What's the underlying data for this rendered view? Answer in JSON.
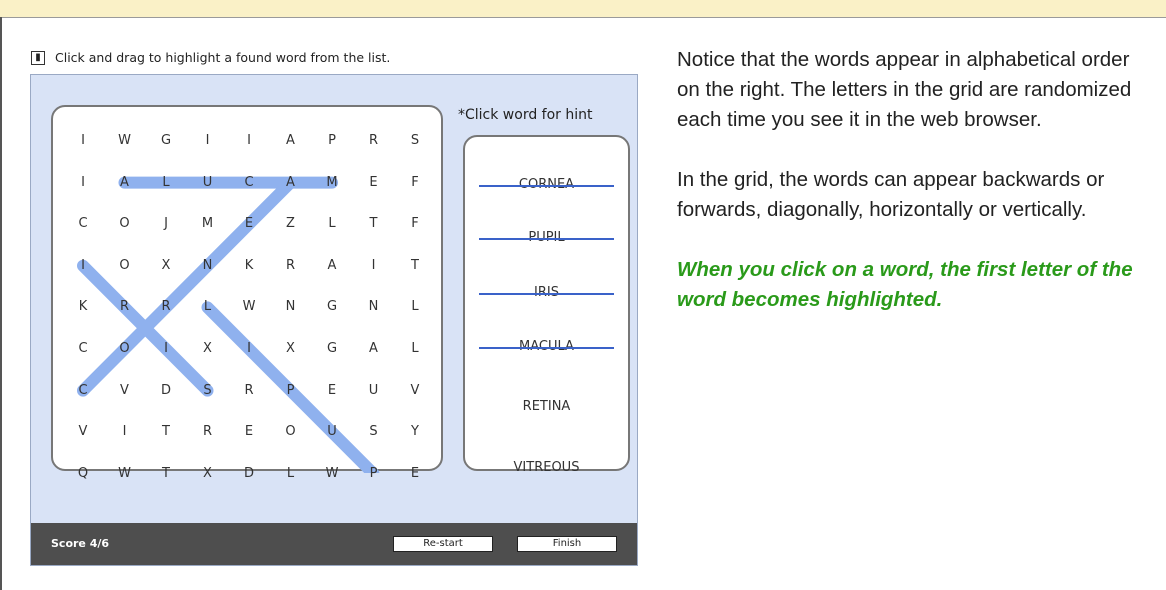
{
  "instruction": {
    "text": "Click and drag to highlight a found word from the list.",
    "icon": "mouse-drag-icon"
  },
  "grid": {
    "rows": [
      [
        "I",
        "W",
        "G",
        "I",
        "I",
        "A",
        "P",
        "R",
        "S"
      ],
      [
        "I",
        "A",
        "L",
        "U",
        "C",
        "A",
        "M",
        "E",
        "F"
      ],
      [
        "C",
        "O",
        "J",
        "M",
        "E",
        "Z",
        "L",
        "T",
        "F"
      ],
      [
        "I",
        "O",
        "X",
        "N",
        "K",
        "R",
        "A",
        "I",
        "T"
      ],
      [
        "K",
        "R",
        "R",
        "L",
        "W",
        "N",
        "G",
        "N",
        "L"
      ],
      [
        "C",
        "O",
        "I",
        "X",
        "I",
        "X",
        "G",
        "A",
        "L"
      ],
      [
        "C",
        "V",
        "D",
        "S",
        "R",
        "P",
        "E",
        "U",
        "V"
      ],
      [
        "V",
        "I",
        "T",
        "R",
        "E",
        "O",
        "U",
        "S",
        "Y"
      ],
      [
        "Q",
        "W",
        "T",
        "X",
        "D",
        "L",
        "W",
        "P",
        "E"
      ]
    ]
  },
  "hint_label": "*Click word for hint",
  "words": [
    {
      "text": "CORNEA",
      "found": true
    },
    {
      "text": "PUPIL",
      "found": true
    },
    {
      "text": "IRIS",
      "found": true
    },
    {
      "text": "MACULA",
      "found": true
    },
    {
      "text": "RETINA",
      "found": false
    },
    {
      "text": "VITREOUS",
      "found": false
    }
  ],
  "found_paths": [
    {
      "word": "MACULA",
      "from": [
        1,
        6
      ],
      "to": [
        1,
        1
      ]
    },
    {
      "word": "CORNEA",
      "from": [
        6,
        0
      ],
      "to": [
        1,
        5
      ]
    },
    {
      "word": "IRIS",
      "from": [
        3,
        0
      ],
      "to": [
        6,
        3
      ]
    },
    {
      "word": "PUPIL",
      "from": [
        8,
        7
      ],
      "to": [
        4,
        3
      ]
    }
  ],
  "bottom_bar": {
    "score": "Score 4/6",
    "restart_label": "Re-start",
    "finish_label": "Finish"
  },
  "right_text": {
    "p1": "Notice that the words appear in alphabetical order on the right. The letters in the grid are randomized each time you see it in the web browser.",
    "p2": "In the grid, the words can appear backwards or forwards, diagonally, horizontally or vertically.",
    "p3": "When you click on a word, the first letter of the word becomes highlighted."
  },
  "colors": {
    "panel_bg": "#d9e3f6",
    "highlight": "#8fb1ee",
    "strike": "#3a62c9",
    "green_text": "#2a9a1a",
    "bottom_bar": "#4e4e4e"
  }
}
